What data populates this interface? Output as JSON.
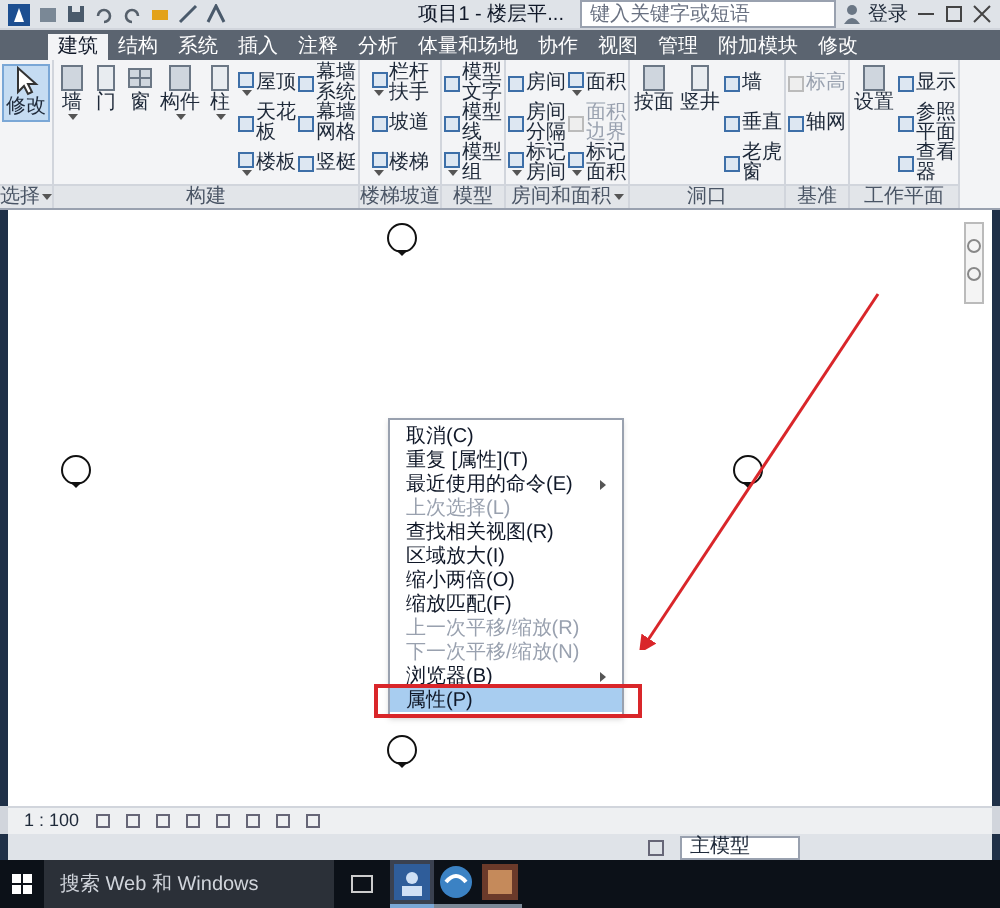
{
  "title_bar": {
    "title": "项目1 - 楼层平...",
    "search": {
      "placeholder": "键入关键字或短语"
    },
    "sign_in": "登录"
  },
  "ribbon_tabs": [
    {
      "label": "建筑",
      "selected": true
    },
    {
      "label": "结构",
      "selected": false
    },
    {
      "label": "系统",
      "selected": false
    },
    {
      "label": "插入",
      "selected": false
    },
    {
      "label": "注释",
      "selected": false
    },
    {
      "label": "分析",
      "selected": false
    },
    {
      "label": "体量和场地",
      "selected": false
    },
    {
      "label": "协作",
      "selected": false
    },
    {
      "label": "视图",
      "selected": false
    },
    {
      "label": "管理",
      "selected": false
    },
    {
      "label": "附加模块",
      "selected": false
    },
    {
      "label": "修改",
      "selected": false
    }
  ],
  "ribbon_panels": [
    {
      "label": "选择",
      "dropdown": true,
      "tools": [
        {
          "kind": "pointer",
          "label": "修改",
          "selected": true
        }
      ]
    },
    {
      "label": "构建",
      "dropdown": false,
      "tools": [
        {
          "kind": "large",
          "label": "墙",
          "dropdown": true
        },
        {
          "kind": "large",
          "label": "门",
          "dropdown": false
        },
        {
          "kind": "large",
          "label": "窗",
          "dropdown": false
        },
        {
          "kind": "large",
          "label": "构件",
          "dropdown": true
        },
        {
          "kind": "large",
          "label": "柱",
          "dropdown": true
        },
        {
          "kind": "stack",
          "items": [
            {
              "label": "屋顶",
              "dropdown": true,
              "disabled": false
            },
            {
              "label": "天花板",
              "dropdown": false,
              "disabled": false
            },
            {
              "label": "楼板",
              "dropdown": true,
              "disabled": false
            }
          ]
        },
        {
          "kind": "stack",
          "items": [
            {
              "label": "幕墙系统",
              "dropdown": false,
              "disabled": false
            },
            {
              "label": "幕墙网格",
              "dropdown": false,
              "disabled": false
            },
            {
              "label": "竖梃",
              "dropdown": false,
              "disabled": false
            }
          ]
        }
      ]
    },
    {
      "label": "楼梯坡道",
      "dropdown": false,
      "tools": [
        {
          "kind": "stack",
          "items": [
            {
              "label": "栏杆扶手",
              "dropdown": true,
              "disabled": false
            },
            {
              "label": "坡道",
              "dropdown": false,
              "disabled": false
            },
            {
              "label": "楼梯",
              "dropdown": true,
              "disabled": false
            }
          ]
        }
      ]
    },
    {
      "label": "模型",
      "dropdown": false,
      "tools": [
        {
          "kind": "stack",
          "items": [
            {
              "label": "模型文字",
              "dropdown": false,
              "disabled": false
            },
            {
              "label": "模型线",
              "dropdown": false,
              "disabled": false
            },
            {
              "label": "模型组",
              "dropdown": true,
              "disabled": false
            }
          ]
        }
      ]
    },
    {
      "label": "房间和面积",
      "dropdown": true,
      "tools": [
        {
          "kind": "stack",
          "items": [
            {
              "label": "房间",
              "dropdown": false,
              "disabled": false
            },
            {
              "label": "房间分隔",
              "dropdown": false,
              "disabled": false
            },
            {
              "label": "标记房间",
              "dropdown": true,
              "disabled": false
            }
          ]
        },
        {
          "kind": "stack",
          "items": [
            {
              "label": "面积",
              "dropdown": true,
              "disabled": false
            },
            {
              "label": "面积边界",
              "dropdown": false,
              "disabled": true
            },
            {
              "label": "标记面积",
              "dropdown": true,
              "disabled": false
            }
          ]
        }
      ]
    },
    {
      "label": "洞口",
      "dropdown": false,
      "tools": [
        {
          "kind": "large",
          "label": "按面",
          "dropdown": false
        },
        {
          "kind": "large",
          "label": "竖井",
          "dropdown": false
        },
        {
          "kind": "stack",
          "items": [
            {
              "label": "墙",
              "dropdown": false,
              "disabled": false
            },
            {
              "label": "垂直",
              "dropdown": false,
              "disabled": false
            },
            {
              "label": "老虎窗",
              "dropdown": false,
              "disabled": false
            }
          ]
        }
      ]
    },
    {
      "label": "基准",
      "dropdown": false,
      "tools": [
        {
          "kind": "stack",
          "items": [
            {
              "label": "标高",
              "dropdown": false,
              "disabled": true
            },
            {
              "label": "轴网",
              "dropdown": false,
              "disabled": false
            }
          ]
        }
      ]
    },
    {
      "label": "工作平面",
      "dropdown": false,
      "tools": [
        {
          "kind": "large",
          "label": "设置",
          "dropdown": false
        },
        {
          "kind": "stack",
          "items": [
            {
              "label": "显示",
              "dropdown": false,
              "disabled": false
            },
            {
              "label": "参照平面",
              "dropdown": false,
              "disabled": false
            },
            {
              "label": "查看器",
              "dropdown": false,
              "disabled": false
            }
          ]
        }
      ]
    }
  ],
  "context_menu": [
    {
      "label": "取消(C)",
      "disabled": false,
      "submenu": false,
      "selected": false
    },
    {
      "label": "重复 [属性](T)",
      "disabled": false,
      "submenu": false,
      "selected": false
    },
    {
      "label": "最近使用的命令(E)",
      "disabled": false,
      "submenu": true,
      "selected": false
    },
    {
      "label": "上次选择(L)",
      "disabled": true,
      "submenu": false,
      "selected": false
    },
    {
      "label": "查找相关视图(R)",
      "disabled": false,
      "submenu": false,
      "selected": false
    },
    {
      "label": "区域放大(I)",
      "disabled": false,
      "submenu": false,
      "selected": false
    },
    {
      "label": "缩小两倍(O)",
      "disabled": false,
      "submenu": false,
      "selected": false
    },
    {
      "label": "缩放匹配(F)",
      "disabled": false,
      "submenu": false,
      "selected": false
    },
    {
      "label": "上一次平移/缩放(R)",
      "disabled": true,
      "submenu": false,
      "selected": false
    },
    {
      "label": "下一次平移/缩放(N)",
      "disabled": true,
      "submenu": false,
      "selected": false
    },
    {
      "label": "浏览器(B)",
      "disabled": false,
      "submenu": true,
      "selected": false
    },
    {
      "label": "属性(P)",
      "disabled": false,
      "submenu": false,
      "selected": true
    }
  ],
  "view_control_bar": {
    "scale": "1 : 100"
  },
  "status_bar": {
    "model": "主模型"
  },
  "taskbar": {
    "search": {
      "placeholder": "搜索 Web 和 Windows"
    }
  }
}
